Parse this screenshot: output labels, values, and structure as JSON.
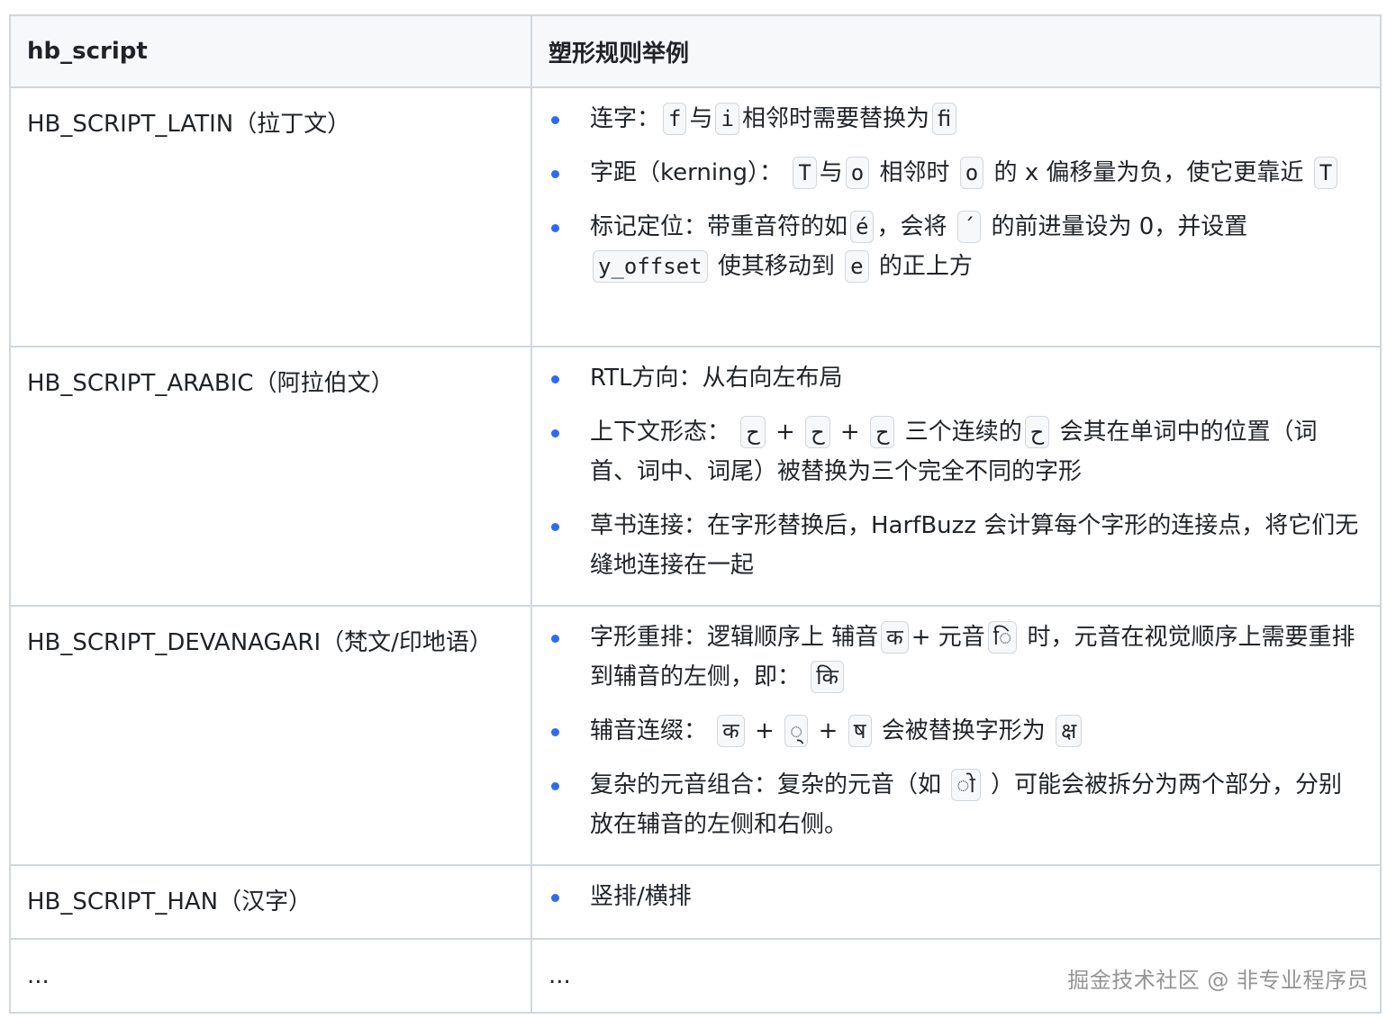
{
  "table": {
    "headers": [
      "hb_script",
      "塑形规则举例"
    ],
    "rows": [
      {
        "script": "HB_SCRIPT_LATIN（拉丁文）",
        "rules": [
          {
            "a": "连字：",
            "c1": "f",
            "b": "与",
            "c2": "i",
            "c": "相邻时需要替换为",
            "c3": "ﬁ"
          },
          {
            "a": "字距（kerning）：",
            "c1": "T",
            "b": "与",
            "c2": "o",
            "c": "相邻时",
            "c3": "o",
            "d": "的 x 偏移量为负，使它更靠近",
            "c4": "T"
          },
          {
            "a": "标记定位：带重音符的如",
            "c1": "é",
            "b": "，会将",
            "c2": "´",
            "c": "的前进量设为 0，并设置",
            "c3": "y_offset",
            "d": "使其移动到",
            "c4": "e",
            "e": "的正上方"
          }
        ]
      },
      {
        "script": "HB_SCRIPT_ARABIC（阿拉伯文）",
        "rules": [
          {
            "a": "RTL方向：从右向左布局"
          },
          {
            "a": "上下文形态：",
            "c1": "ح",
            "b": "+",
            "c2": "ح",
            "c": "+",
            "c3": "ح",
            "d": "三个连续的",
            "c4": "ح",
            "e": "会其在单词中的位置（词首、词中、词尾）被替换为三个完全不同的字形"
          },
          {
            "a": "草书连接：在字形替换后，HarfBuzz 会计算每个字形的连接点，将它们无缝地连接在一起"
          }
        ]
      },
      {
        "script": "HB_SCRIPT_DEVANAGARI（梵文/印地语）",
        "rules": [
          {
            "a": "字形重排：逻辑顺序上 辅音",
            "c1": "क",
            "b": "+ 元音",
            "c2": "ि",
            "c": "时，元音在视觉顺序上需要重排到辅音的左侧，即：",
            "c3": "कि"
          },
          {
            "a": "辅音连缀：",
            "c1": "क",
            "b": "+",
            "c2": "्",
            "c": "+",
            "c3": "ष",
            "d": "会被替换字形为",
            "c4": "क्ष"
          },
          {
            "a": "复杂的元音组合：复杂的元音（如",
            "c1": "ो",
            "b": "）可能会被拆分为两个部分，分别放在辅音的左侧和右侧。"
          }
        ]
      },
      {
        "script": "HB_SCRIPT_HAN（汉字）",
        "rules": [
          {
            "a": "竖排/横排"
          }
        ]
      },
      {
        "script": "...",
        "rules_text": "..."
      }
    ]
  },
  "watermark": "掘金技术社区 @ 非专业程序员"
}
